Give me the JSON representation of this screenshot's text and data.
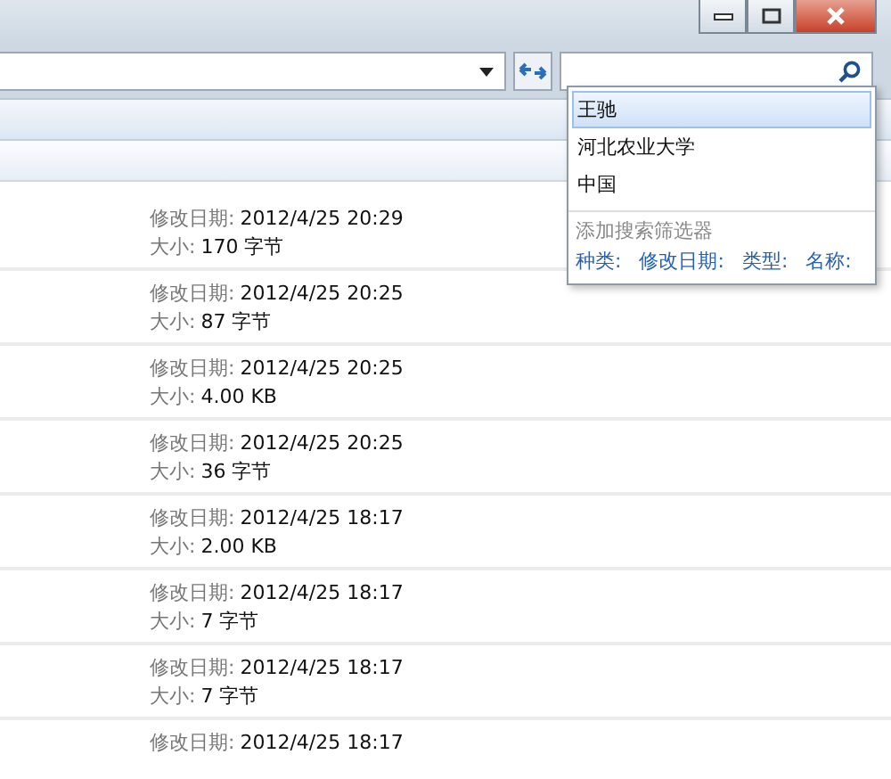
{
  "search": {
    "suggestions": [
      {
        "label": "王驰",
        "selected": true
      },
      {
        "label": "河北农业大学",
        "selected": false
      },
      {
        "label": "中国",
        "selected": false
      }
    ],
    "filter_hint": "添加搜索筛选器",
    "filters": [
      "种类:",
      "修改日期:",
      "类型:",
      "名称:"
    ]
  },
  "files": [
    {
      "date_label": "修改日期:",
      "date": "2012/4/25 20:29",
      "size_label": "大小:",
      "size": "170 字节"
    },
    {
      "date_label": "修改日期:",
      "date": "2012/4/25 20:25",
      "size_label": "大小:",
      "size": "87 字节"
    },
    {
      "date_label": "修改日期:",
      "date": "2012/4/25 20:25",
      "size_label": "大小:",
      "size": "4.00 KB"
    },
    {
      "date_label": "修改日期:",
      "date": "2012/4/25 20:25",
      "size_label": "大小:",
      "size": "36 字节"
    },
    {
      "date_label": "修改日期:",
      "date": "2012/4/25 18:17",
      "size_label": "大小:",
      "size": "2.00 KB"
    },
    {
      "date_label": "修改日期:",
      "date": "2012/4/25 18:17",
      "size_label": "大小:",
      "size": "7 字节"
    },
    {
      "date_label": "修改日期:",
      "date": "2012/4/25 18:17",
      "size_label": "大小:",
      "size": "7 字节"
    },
    {
      "date_label": "修改日期:",
      "date": "2012/4/25 18:17"
    }
  ]
}
